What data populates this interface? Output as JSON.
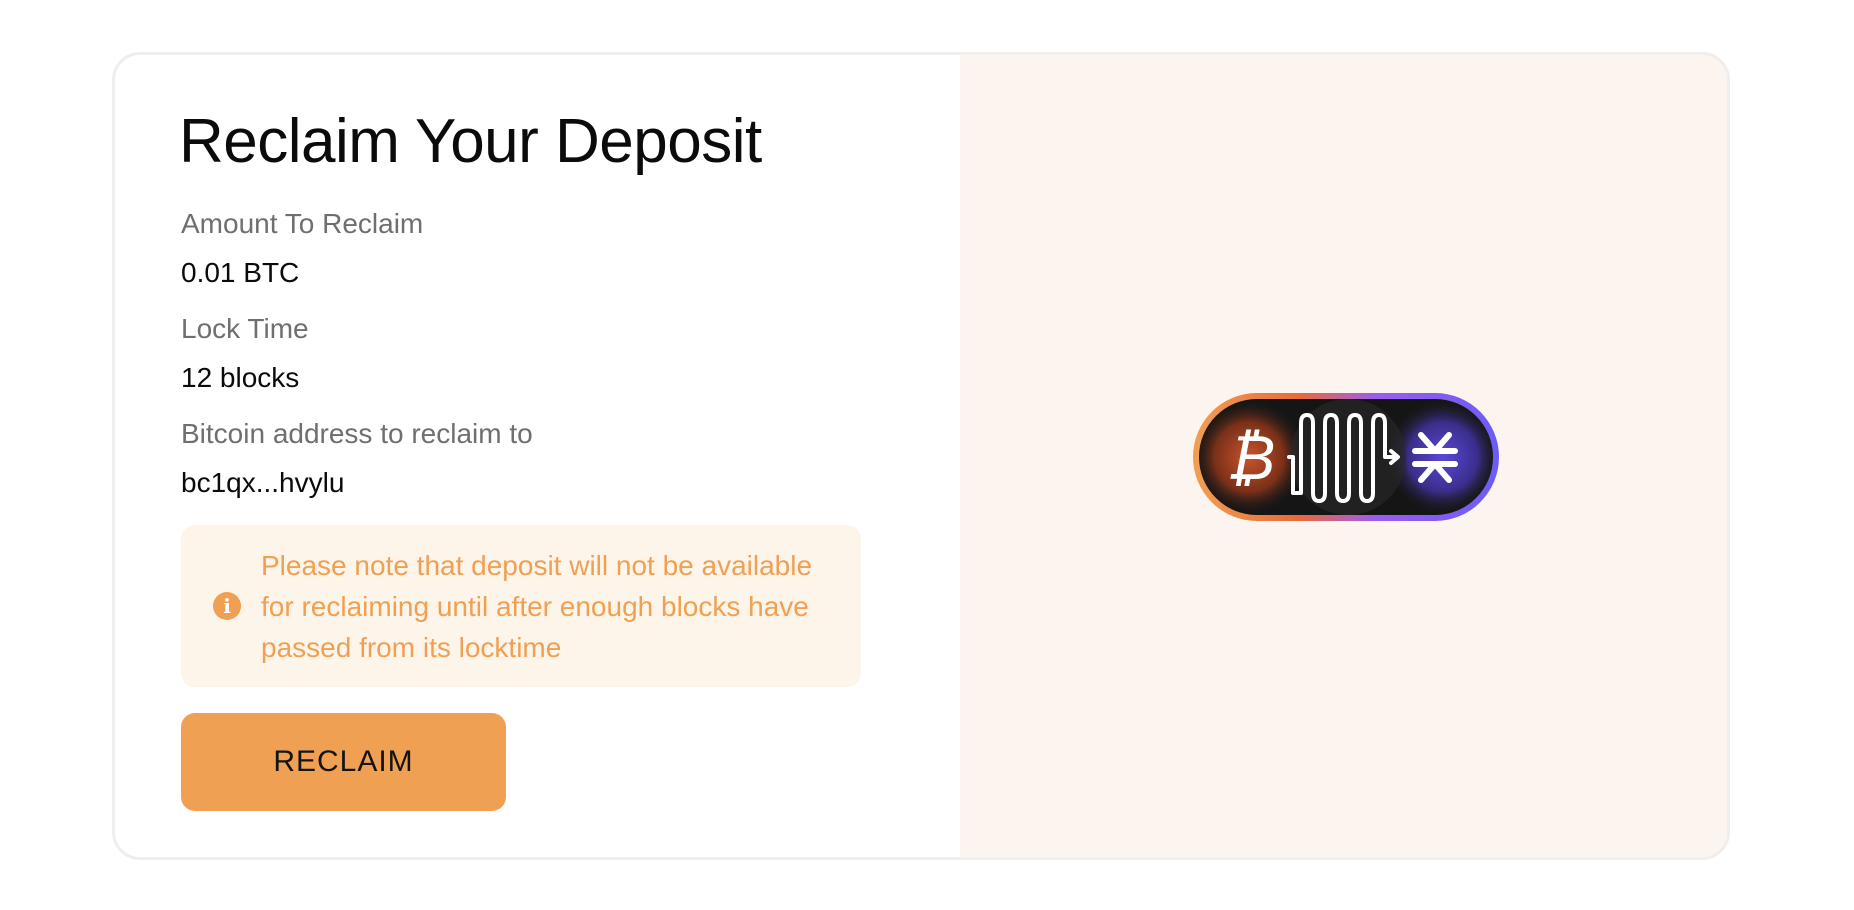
{
  "page": {
    "title": "Reclaim Your Deposit"
  },
  "fields": {
    "amount_label": "Amount To Reclaim",
    "amount_value": "0.01 BTC",
    "lock_label": "Lock Time",
    "lock_value": "12 blocks",
    "address_label": "Bitcoin address to reclaim to",
    "address_value": "bc1qx...hvylu"
  },
  "notice": {
    "icon": "info-icon",
    "text": "Please note that deposit will not be available for reclaiming until after enough blocks have passed from its locktime"
  },
  "actions": {
    "reclaim_label": "RECLAIM"
  },
  "illustration": {
    "icons": [
      "bitcoin-icon",
      "wave-icon",
      "stacks-icon"
    ]
  },
  "colors": {
    "accent": "#f0a052",
    "notice_bg": "#fdf4ea",
    "panel_bg": "#fcf4ef",
    "stacks_purple": "#6b5cf5"
  }
}
